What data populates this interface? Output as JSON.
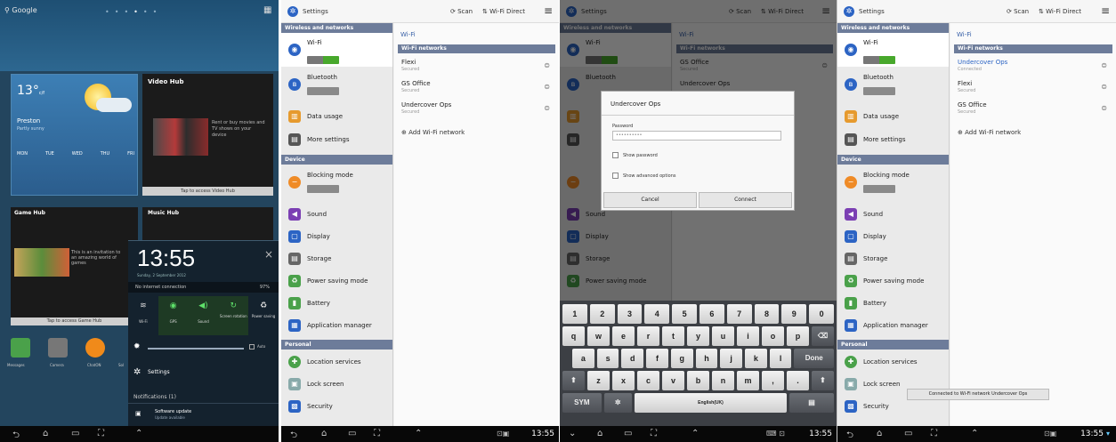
{
  "home": {
    "search_label": "Google",
    "apps_icon": "grid-icon",
    "weather": {
      "temp": "13°",
      "unit": "c/f",
      "city": "Preston",
      "desc": "Partly sunny",
      "days": [
        "MON",
        "TUE",
        "WED",
        "THU",
        "FRI"
      ]
    },
    "video_hub": {
      "title": "Video Hub",
      "text": "Rent or buy movies and TV shows on your device",
      "action": "Tap to access Video Hub"
    },
    "game_hub": {
      "title": "Game Hub",
      "text": "This is an invitation to an amazing world of games",
      "action": "Tap to access Game Hub"
    },
    "music_hub": {
      "title": "Music Hub"
    },
    "dock": [
      "Messages",
      "Camera",
      "ChatON",
      "Sol"
    ]
  },
  "notification": {
    "time": "13:55",
    "date": "Sunday, 2 September 2012",
    "connection": "No internet connection",
    "battery_pct": "97%",
    "toggles": [
      "Wi-Fi",
      "GPS",
      "Sound",
      "Screen rotation",
      "Power saving"
    ],
    "auto_label": "Auto",
    "settings_label": "Settings",
    "notifications_label": "Notifications (1)",
    "update_title": "Software update",
    "update_sub": "Update available"
  },
  "settings": {
    "title": "Settings",
    "scan_label": "Scan",
    "wifi_direct_label": "Wi-Fi Direct",
    "sections": {
      "wireless": "Wireless and networks",
      "device": "Device",
      "personal": "Personal"
    },
    "items": {
      "wifi": "Wi-Fi",
      "bluetooth": "Bluetooth",
      "data_usage": "Data usage",
      "more_settings": "More settings",
      "blocking_mode": "Blocking mode",
      "sound": "Sound",
      "display": "Display",
      "storage": "Storage",
      "power_saving": "Power saving mode",
      "battery": "Battery",
      "app_manager": "Application manager",
      "location": "Location services",
      "lock_screen": "Lock screen",
      "security": "Security"
    },
    "wifi_title": "Wi-Fi",
    "wifi_networks_header": "Wi-Fi networks",
    "networks": [
      {
        "name": "Flexi",
        "status": "Secured"
      },
      {
        "name": "GS Office",
        "status": "Secured"
      },
      {
        "name": "Undercover Ops",
        "status": "Secured"
      }
    ],
    "add_network": "Add Wi-Fi network",
    "networks_connected": [
      {
        "name": "Undercover Ops",
        "status": "Connected"
      },
      {
        "name": "Flexi",
        "status": "Secured"
      },
      {
        "name": "GS Office",
        "status": "Secured"
      }
    ],
    "toast": "Connected to Wi-Fi network Undercover Ops"
  },
  "dialog": {
    "title": "Undercover Ops",
    "password_label": "Password",
    "password_value": "••••••••••",
    "show_password": "Show password",
    "show_advanced": "Show advanced options",
    "cancel": "Cancel",
    "connect": "Connect"
  },
  "keyboard": {
    "row1": [
      "1",
      "2",
      "3",
      "4",
      "5",
      "6",
      "7",
      "8",
      "9",
      "0"
    ],
    "row2": [
      "q",
      "w",
      "e",
      "r",
      "t",
      "y",
      "u",
      "i",
      "o",
      "p"
    ],
    "row3": [
      "a",
      "s",
      "d",
      "f",
      "g",
      "h",
      "j",
      "k",
      "l"
    ],
    "done": "Done",
    "row4": [
      "z",
      "x",
      "c",
      "v",
      "b",
      "n",
      "m",
      ",",
      "."
    ],
    "sym": "SYM",
    "space": "English(UK)"
  },
  "status": {
    "clock": "13:55"
  },
  "colors": {
    "accent": "#2c64c4",
    "header": "#6d7c9a",
    "switch_on": "#48a82c"
  }
}
